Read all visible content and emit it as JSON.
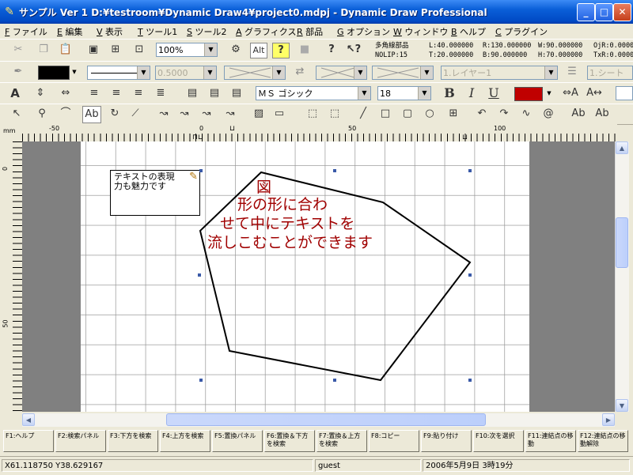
{
  "window": {
    "title": "サンプル Ver 1 D:¥testroom¥Dynamic Draw4¥project0.mdpj - Dynamic Draw Professional",
    "minimize": "_",
    "maximize": "□",
    "close": "✕"
  },
  "menu": [
    {
      "key": "F",
      "label": "ファイル"
    },
    {
      "key": "E",
      "label": "編集"
    },
    {
      "key": "V",
      "label": "表示"
    },
    {
      "key": "T",
      "label": "ツール1"
    },
    {
      "key": "S",
      "label": "ツール2"
    },
    {
      "key": "A",
      "label": "グラフィクス"
    },
    {
      "key": "R",
      "label": "部品"
    },
    {
      "key": "G",
      "label": "オプション"
    },
    {
      "key": "W",
      "label": "ウィンドウ"
    },
    {
      "key": "B",
      "label": "ヘルプ"
    },
    {
      "key": "C",
      "label": "プラグイン"
    }
  ],
  "toolbar1": {
    "zoom": "100%",
    "alt_label": "Alt",
    "help_label": "?",
    "info": {
      "name": "多角線部品",
      "nolp": "NOLIP:15",
      "l": "L:40.000000",
      "t": "T:20.000000",
      "r": "R:130.000000",
      "b": "B:90.000000",
      "w": "W:90.000000",
      "h": "H:70.000000",
      "ojr": "OjR:0.000000",
      "txr": "TxR:0.000000"
    }
  },
  "toolbar2": {
    "line_width": "0.5000",
    "layer": "1.レイヤー1",
    "sheet": "1.シート"
  },
  "toolbar3": {
    "font": "ＭＳ ゴシック",
    "size": "18",
    "bold": "B",
    "italic": "I",
    "underline": "U",
    "fill_color": "#c00000"
  },
  "ruler": {
    "unit": "mm",
    "h_labels": [
      "-50",
      "0",
      "50",
      "100"
    ],
    "v_labels": [
      "0",
      "50"
    ]
  },
  "canvas": {
    "note_text": "テキストの表現力も魅力です",
    "shape_text_lines": [
      "図",
      "形の形に合わ",
      "せて中にテキストを",
      "流しこむことができます"
    ],
    "text_color": "#a00000"
  },
  "fkeys": [
    "F1:ヘルプ",
    "F2:検索パネル",
    "F3:下方を検索",
    "F4:上方を検索",
    "F5:置換パネル",
    "F6:置換＆下方を検索",
    "F7:置換＆上方を検索",
    "F8:コピー",
    "F9:貼り付け",
    "F10:次を選択",
    "F11:連結点の移動",
    "F12:連結点の移動解除"
  ],
  "status": {
    "coords": "X61.118750 Y38.629167",
    "user": "guest",
    "datetime": "2006年5月9日 3時19分"
  }
}
